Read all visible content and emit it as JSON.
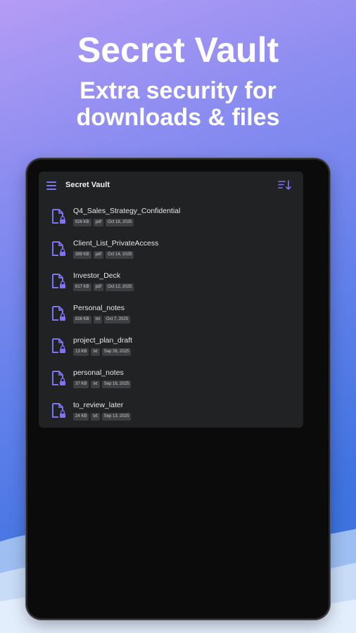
{
  "promo": {
    "title": "Secret Vault",
    "subtitle_line1": "Extra security for",
    "subtitle_line2": "downloads & files"
  },
  "app": {
    "title": "Secret Vault",
    "menu_icon": "hamburger-menu-icon",
    "sort_icon": "sort-icon",
    "accent_color": "#7c74f0"
  },
  "files": [
    {
      "name": "Q4_Sales_Strategy_Confidential",
      "size": "926 KB",
      "type": "pdf",
      "date": "Oct 18, 2025"
    },
    {
      "name": "Client_List_PrivateAccess",
      "size": "389 KB",
      "type": "pdf",
      "date": "Oct 14, 2025"
    },
    {
      "name": "Investor_Deck",
      "size": "617 KB",
      "type": "pdf",
      "date": "Oct 12, 2025"
    },
    {
      "name": "Personal_notes",
      "size": "826 KB",
      "type": "txt",
      "date": "Oct 7, 2025"
    },
    {
      "name": "project_plan_draft",
      "size": "13 KB",
      "type": "txt",
      "date": "Sep 26, 2025"
    },
    {
      "name": "personal_notes",
      "size": "37 KB",
      "type": "txt",
      "date": "Sep 16, 2025"
    },
    {
      "name": "to_review_later",
      "size": "24 KB",
      "type": "txt",
      "date": "Sep 13, 2025"
    }
  ]
}
